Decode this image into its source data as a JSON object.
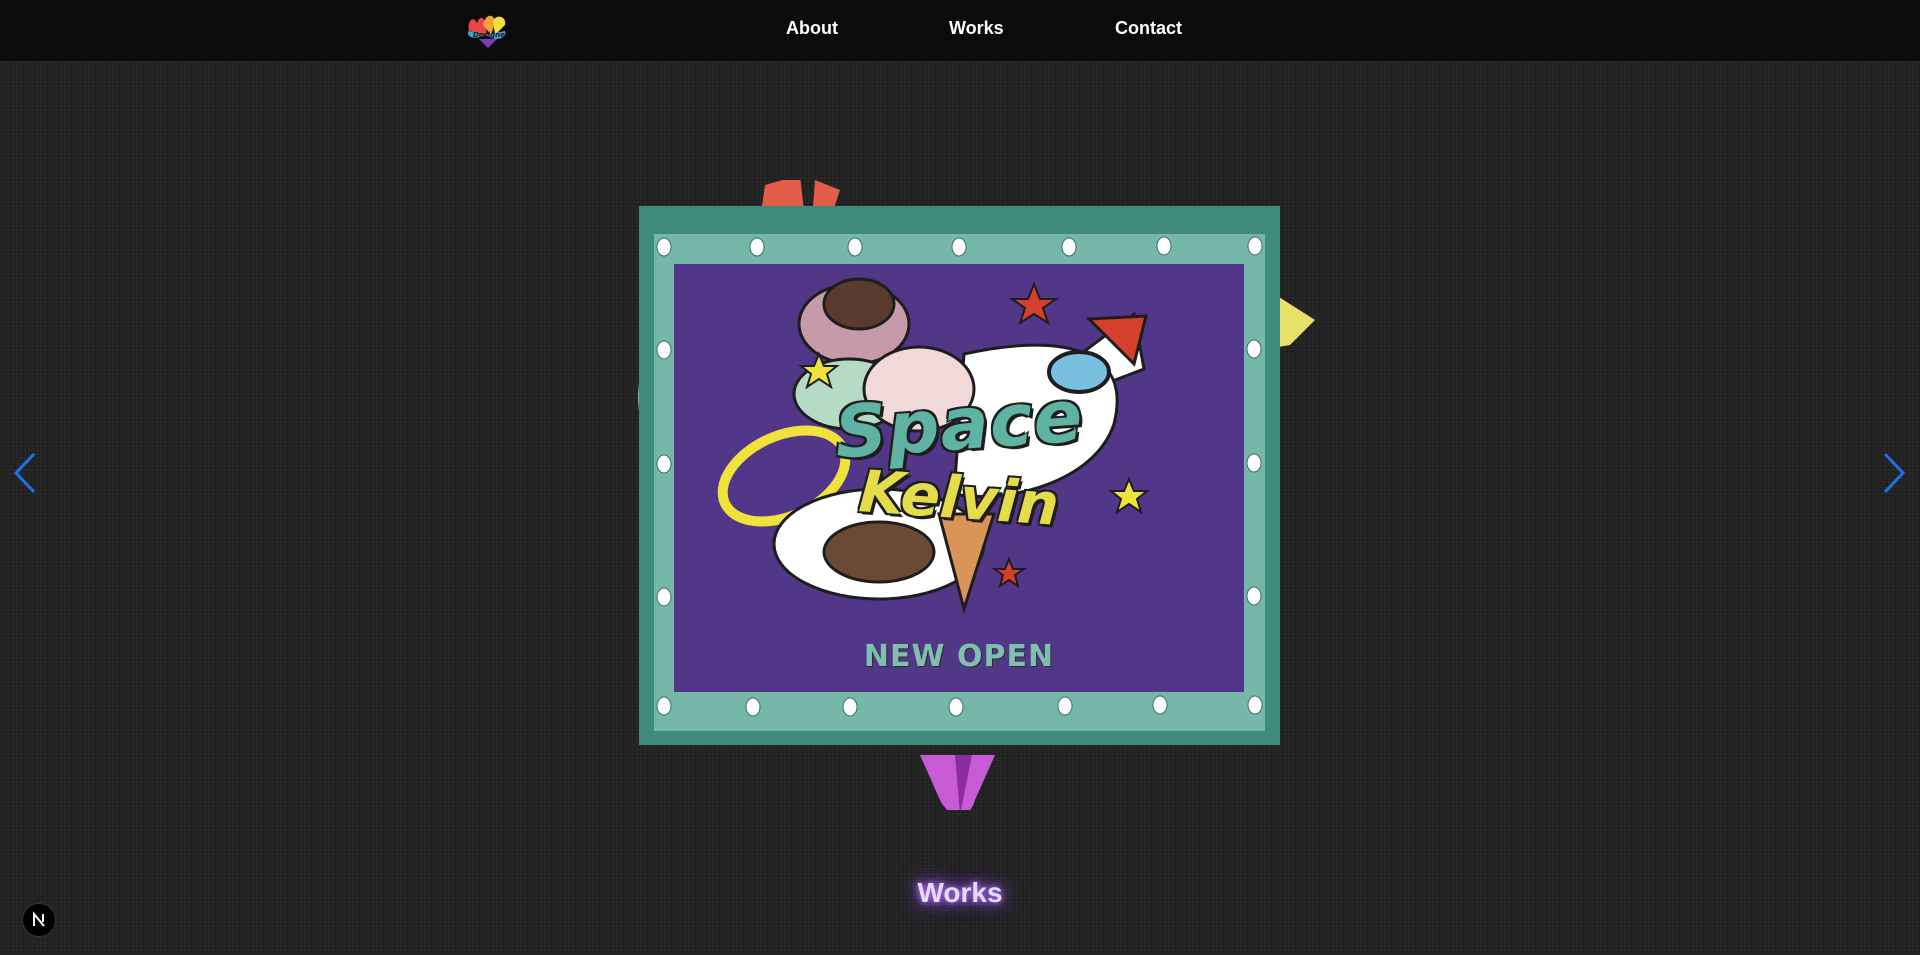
{
  "nav": {
    "logo_icon": "designer-logo-icon",
    "links": [
      {
        "label": "About"
      },
      {
        "label": "Works"
      },
      {
        "label": "Contact"
      }
    ]
  },
  "carousel": {
    "prev_icon": "chevron-left-icon",
    "next_icon": "chevron-right-icon",
    "arrow_color": "#1a73e8",
    "slide": {
      "sign_text_line_1": "Space",
      "sign_text_line_2": "Kelvin",
      "sign_text_line_3": "NEW OPEN"
    }
  },
  "section": {
    "title": "Works"
  },
  "badge": {
    "icon": "nextjs-logo-icon",
    "text": "N"
  },
  "colors": {
    "navbar": "#0b0b0b",
    "background": "#232323",
    "sign_frame": "#3f8a7c",
    "sign_inner": "#75b7a9",
    "sign_panel": "#523789",
    "title_glow": "#9b5cf0"
  }
}
